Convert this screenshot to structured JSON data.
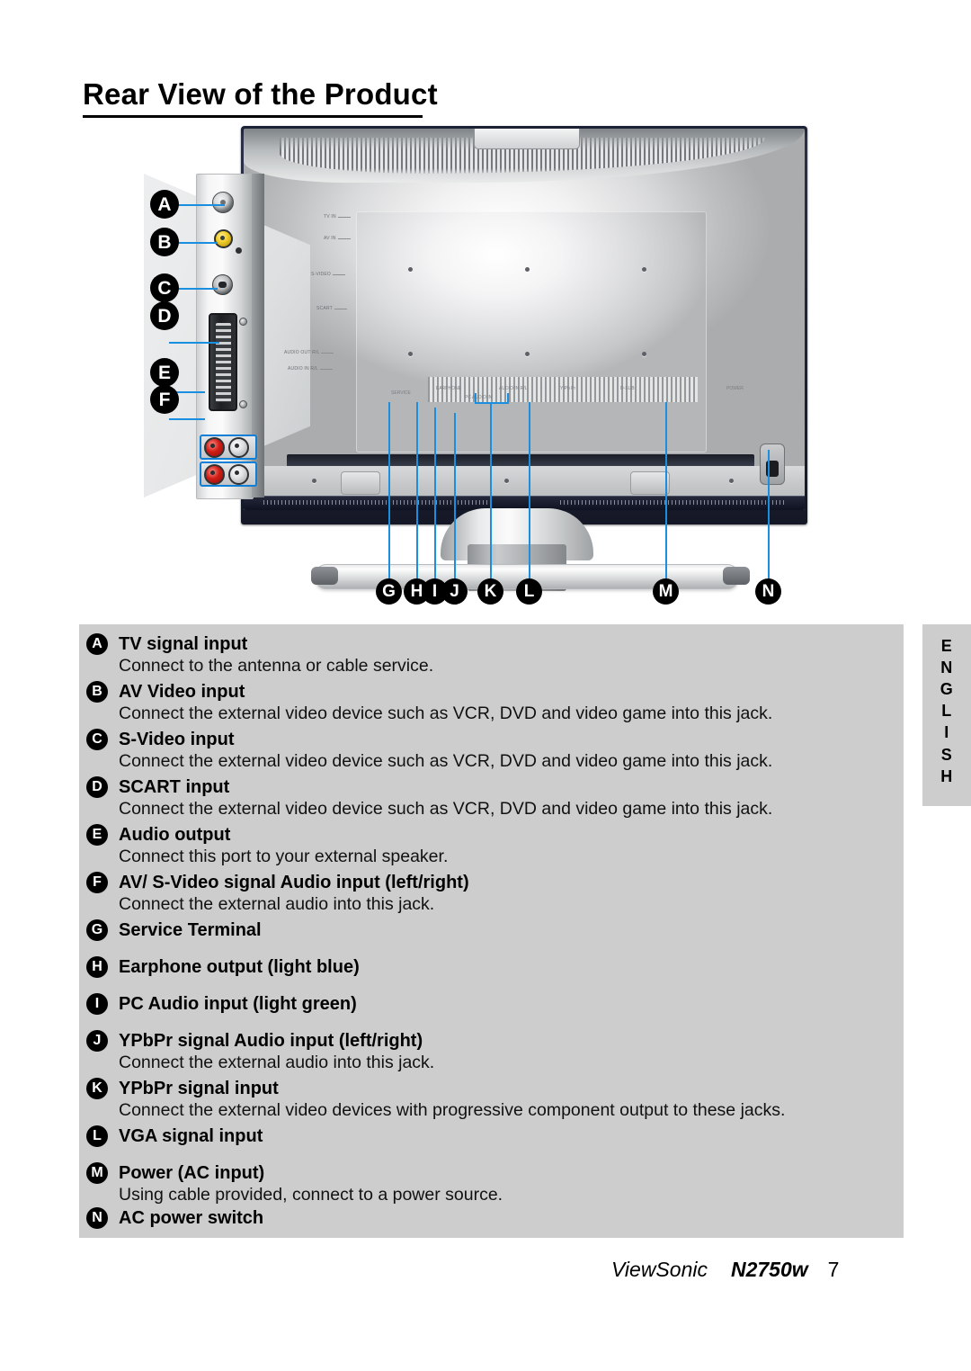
{
  "document": {
    "title": "Rear View of the Product"
  },
  "figure": {
    "name": "rear-view-diagram",
    "panel_labels": [
      {
        "id": "tv-in",
        "text": "TV IN"
      },
      {
        "id": "av-in",
        "text": "AV IN"
      },
      {
        "id": "s-video",
        "text": "S-VIDEO"
      },
      {
        "id": "scart",
        "text": "SCART"
      },
      {
        "id": "audio-out",
        "text": "AUDIO OUT R/L"
      },
      {
        "id": "audio-in",
        "text": "AUDIO IN R/L"
      }
    ],
    "bottom_labels": [
      {
        "id": "service",
        "text": "SERVICE"
      },
      {
        "id": "earphone",
        "text": "EARPHONE"
      },
      {
        "id": "pc-audio-in",
        "text": "PC AUDIO IN"
      },
      {
        "id": "audio-in-rl",
        "text": "AUDIO IN R/L"
      },
      {
        "id": "ypbpr",
        "text": "Y Pb Pr"
      },
      {
        "id": "d-sub",
        "text": "D-SUB"
      },
      {
        "id": "power",
        "text": "POWER"
      }
    ],
    "callouts_left": [
      "A",
      "B",
      "C",
      "D",
      "E",
      "F"
    ],
    "callouts_bottom": [
      "G",
      "H",
      "I",
      "J",
      "K",
      "L",
      "M",
      "N"
    ],
    "colors": {
      "lead_line": "#1a8fe0",
      "badge_fill": "#000000",
      "badge_text": "#ffffff",
      "panel_bg": "#cdcdcd"
    }
  },
  "descriptions": [
    {
      "letter": "A",
      "heading": "TV signal input",
      "body": "Connect to the antenna or cable service."
    },
    {
      "letter": "B",
      "heading": "AV Video input",
      "body": "Connect the external video device such as VCR, DVD and video game into this jack."
    },
    {
      "letter": "C",
      "heading": "S-Video input",
      "body": "Connect the external video device such as VCR, DVD and video game into this jack."
    },
    {
      "letter": "D",
      "heading": "SCART input",
      "body": "Connect the external video device such as VCR, DVD and video game into this jack."
    },
    {
      "letter": "E",
      "heading": "Audio output",
      "body": "Connect this port to your external speaker."
    },
    {
      "letter": "F",
      "heading": "AV/ S-Video signal Audio input (left/right)",
      "body": "Connect the external audio into this jack."
    },
    {
      "letter": "G",
      "heading": "Service Terminal",
      "body": ""
    },
    {
      "letter": "H",
      "heading": "Earphone output (light blue)",
      "body": ""
    },
    {
      "letter": "I",
      "heading": "PC Audio input (light green)",
      "body": ""
    },
    {
      "letter": "J",
      "heading": "YPbPr signal Audio input (left/right)",
      "body": "Connect the external audio into this jack."
    },
    {
      "letter": "K",
      "heading": "YPbPr signal input",
      "body": "Connect the external video devices with progressive component output to these jacks."
    },
    {
      "letter": "L",
      "heading": "VGA signal input",
      "body": ""
    },
    {
      "letter": "M",
      "heading": "Power (AC input)",
      "body": "Using cable provided, connect to a power source."
    },
    {
      "letter": "N",
      "heading": "AC power switch",
      "body": ""
    }
  ],
  "side_tab": {
    "label": "ENGLISH",
    "letters": [
      "E",
      "N",
      "G",
      "L",
      "I",
      "S",
      "H"
    ]
  },
  "footer": {
    "brand": "ViewSonic",
    "model": "N2750w",
    "page": "7"
  }
}
